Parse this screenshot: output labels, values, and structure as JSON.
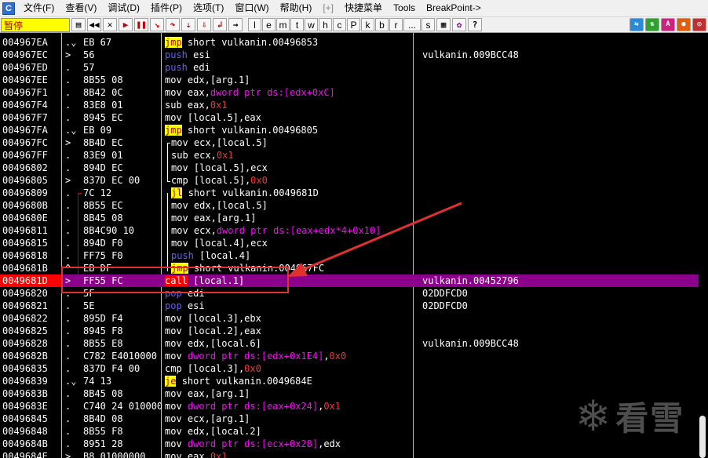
{
  "menu": {
    "items": [
      "文件(F)",
      "查看(V)",
      "调试(D)",
      "插件(P)",
      "选项(T)",
      "窗口(W)",
      "帮助(H)",
      "[+]",
      "快捷菜单",
      "Tools",
      "BreakPoint->"
    ]
  },
  "toolbar": {
    "status": "暂停",
    "letters": [
      "l",
      "e",
      "m",
      "t",
      "w",
      "h",
      "c",
      "P",
      "k",
      "b",
      "r",
      "...",
      "s"
    ]
  },
  "rows": [
    {
      "addr": "004967EA",
      "mark": ".⌄",
      "hex": "EB 67",
      "mn": "jmp",
      "ops": [
        [
          "short vulkanin.00496853",
          "plain"
        ]
      ],
      "cmt": ""
    },
    {
      "addr": "004967EC",
      "mark": ">",
      "hex": "56",
      "mn": "push",
      "ops": [
        [
          "esi",
          "plain"
        ]
      ],
      "cmt": "vulkanin.009BCC48"
    },
    {
      "addr": "004967ED",
      "mark": ".",
      "hex": "57",
      "mn": "push",
      "ops": [
        [
          "edi",
          "plain"
        ]
      ],
      "cmt": ""
    },
    {
      "addr": "004967EE",
      "mark": ".",
      "hex": "8B55 08",
      "mn": "mov",
      "ops": [
        [
          "edx,",
          "plain"
        ],
        [
          "[arg.1]",
          "plain"
        ]
      ],
      "cmt": ""
    },
    {
      "addr": "004967F1",
      "mark": ".",
      "hex": "8B42 0C",
      "mn": "mov",
      "ops": [
        [
          "eax,",
          "plain"
        ],
        [
          "dword ptr ds:[edx+0xC]",
          "mem"
        ]
      ],
      "cmt": ""
    },
    {
      "addr": "004967F4",
      "mark": ".",
      "hex": "83E8 01",
      "mn": "sub",
      "ops": [
        [
          "eax,",
          "plain"
        ],
        [
          "0x1",
          "num"
        ]
      ],
      "cmt": ""
    },
    {
      "addr": "004967F7",
      "mark": ".",
      "hex": "8945 EC",
      "mn": "mov",
      "ops": [
        [
          "[local.5],eax",
          "plain"
        ]
      ],
      "cmt": ""
    },
    {
      "addr": "004967FA",
      "mark": ".⌄",
      "hex": "EB 09",
      "mn": "jmp",
      "ops": [
        [
          "short vulkanin.00496805",
          "plain"
        ]
      ],
      "cmt": ""
    },
    {
      "addr": "004967FC",
      "mark": ">",
      "hex": "8B4D EC",
      "mn": "mov",
      "ops": [
        [
          "ecx,[local.5]",
          "plain"
        ]
      ],
      "cmt": ""
    },
    {
      "addr": "004967FF",
      "mark": ".",
      "hex": "83E9 01",
      "mn": "sub",
      "ops": [
        [
          "ecx,",
          "plain"
        ],
        [
          "0x1",
          "num"
        ]
      ],
      "cmt": ""
    },
    {
      "addr": "00496802",
      "mark": ".",
      "hex": "894D EC",
      "mn": "mov",
      "ops": [
        [
          "[local.5],ecx",
          "plain"
        ]
      ],
      "cmt": ""
    },
    {
      "addr": "00496805",
      "mark": ">",
      "hex": "837D EC 00",
      "mn": "cmp",
      "ops": [
        [
          "[local.5],",
          "plain"
        ],
        [
          "0x0",
          "num"
        ]
      ],
      "cmt": ""
    },
    {
      "addr": "00496809",
      "mark": ".",
      "hex": "7C 12",
      "mn": "jl",
      "ops": [
        [
          "short vulkanin.0049681D",
          "plain"
        ]
      ],
      "cmt": ""
    },
    {
      "addr": "0049680B",
      "mark": ".",
      "hex": "8B55 EC",
      "mn": "mov",
      "ops": [
        [
          "edx,[local.5]",
          "plain"
        ]
      ],
      "cmt": ""
    },
    {
      "addr": "0049680E",
      "mark": ".",
      "hex": "8B45 08",
      "mn": "mov",
      "ops": [
        [
          "eax,[arg.1]",
          "plain"
        ]
      ],
      "cmt": ""
    },
    {
      "addr": "00496811",
      "mark": ".",
      "hex": "8B4C90 10",
      "mn": "mov",
      "ops": [
        [
          "ecx,",
          "plain"
        ],
        [
          "dword ptr ds:[eax+edx*4+0x10]",
          "mem"
        ]
      ],
      "cmt": ""
    },
    {
      "addr": "00496815",
      "mark": ".",
      "hex": "894D F0",
      "mn": "mov",
      "ops": [
        [
          "[local.4],ecx",
          "plain"
        ]
      ],
      "cmt": ""
    },
    {
      "addr": "00496818",
      "mark": ".",
      "hex": "FF75 F0",
      "mn": "push",
      "ops": [
        [
          "[local.4]",
          "plain"
        ]
      ],
      "cmt": ""
    },
    {
      "addr": "0049681B",
      "mark": "^",
      "hex": "EB DF",
      "mn": "jmp",
      "ops": [
        [
          "short vulkanin.004967FC",
          "plain"
        ]
      ],
      "cmt": ""
    },
    {
      "addr": "0049681D",
      "mark": ">",
      "hex": "FF55 FC",
      "mn": "call",
      "ops": [
        [
          "[local.1]",
          "plain"
        ]
      ],
      "cmt": "vulkanin.00452796",
      "sel": true
    },
    {
      "addr": "00496820",
      "mark": ".",
      "hex": "5F",
      "mn": "pop",
      "ops": [
        [
          "edi",
          "plain"
        ]
      ],
      "cmt": "02DDFCD0"
    },
    {
      "addr": "00496821",
      "mark": ".",
      "hex": "5E",
      "mn": "pop",
      "ops": [
        [
          "esi",
          "plain"
        ]
      ],
      "cmt": "02DDFCD0"
    },
    {
      "addr": "00496822",
      "mark": ".",
      "hex": "895D F4",
      "mn": "mov",
      "ops": [
        [
          "[local.3],ebx",
          "plain"
        ]
      ],
      "cmt": ""
    },
    {
      "addr": "00496825",
      "mark": ".",
      "hex": "8945 F8",
      "mn": "mov",
      "ops": [
        [
          "[local.2],eax",
          "plain"
        ]
      ],
      "cmt": ""
    },
    {
      "addr": "00496828",
      "mark": ".",
      "hex": "8B55 E8",
      "mn": "mov",
      "ops": [
        [
          "edx,[local.6]",
          "plain"
        ]
      ],
      "cmt": "vulkanin.009BCC48"
    },
    {
      "addr": "0049682B",
      "mark": ".",
      "hex": "C782 E4010000",
      "mn": "mov",
      "ops": [
        [
          "dword ptr ds:[edx+0x1E4]",
          "mem"
        ],
        [
          ",",
          "plain"
        ],
        [
          "0x0",
          "num"
        ]
      ],
      "cmt": ""
    },
    {
      "addr": "00496835",
      "mark": ".",
      "hex": "837D F4 00",
      "mn": "cmp",
      "ops": [
        [
          "[local.3],",
          "plain"
        ],
        [
          "0x0",
          "num"
        ]
      ],
      "cmt": ""
    },
    {
      "addr": "00496839",
      "mark": ".⌄",
      "hex": "74 13",
      "mn": "je",
      "ops": [
        [
          "short vulkanin.0049684E",
          "plain"
        ]
      ],
      "cmt": ""
    },
    {
      "addr": "0049683B",
      "mark": ".",
      "hex": "8B45 08",
      "mn": "mov",
      "ops": [
        [
          "eax,[arg.1]",
          "plain"
        ]
      ],
      "cmt": ""
    },
    {
      "addr": "0049683E",
      "mark": ".",
      "hex": "C740 24 01000000",
      "mn": "mov",
      "ops": [
        [
          "dword ptr ds:[eax+0x24]",
          "mem"
        ],
        [
          ",",
          "plain"
        ],
        [
          "0x1",
          "num"
        ]
      ],
      "cmt": ""
    },
    {
      "addr": "00496845",
      "mark": ".",
      "hex": "8B4D 08",
      "mn": "mov",
      "ops": [
        [
          "ecx,[arg.1]",
          "plain"
        ]
      ],
      "cmt": ""
    },
    {
      "addr": "00496848",
      "mark": ".",
      "hex": "8B55 F8",
      "mn": "mov",
      "ops": [
        [
          "edx,[local.2]",
          "plain"
        ]
      ],
      "cmt": ""
    },
    {
      "addr": "0049684B",
      "mark": ".",
      "hex": "8951 28",
      "mn": "mov",
      "ops": [
        [
          "dword ptr ds:[ecx+0x28]",
          "mem"
        ],
        [
          ",edx",
          "plain"
        ]
      ],
      "cmt": ""
    },
    {
      "addr": "0049684E",
      "mark": ">",
      "hex": "B8 01000000",
      "mn": "mov",
      "ops": [
        [
          "eax,",
          "plain"
        ],
        [
          "0x1",
          "num"
        ]
      ],
      "cmt": ""
    }
  ],
  "watermark": {
    "text": "看雪"
  },
  "colors": {
    "selected_row": "#8b008b",
    "jump_highlight": "#ffff00",
    "call_highlight": "#ff0000",
    "annotation": "#e03030"
  }
}
